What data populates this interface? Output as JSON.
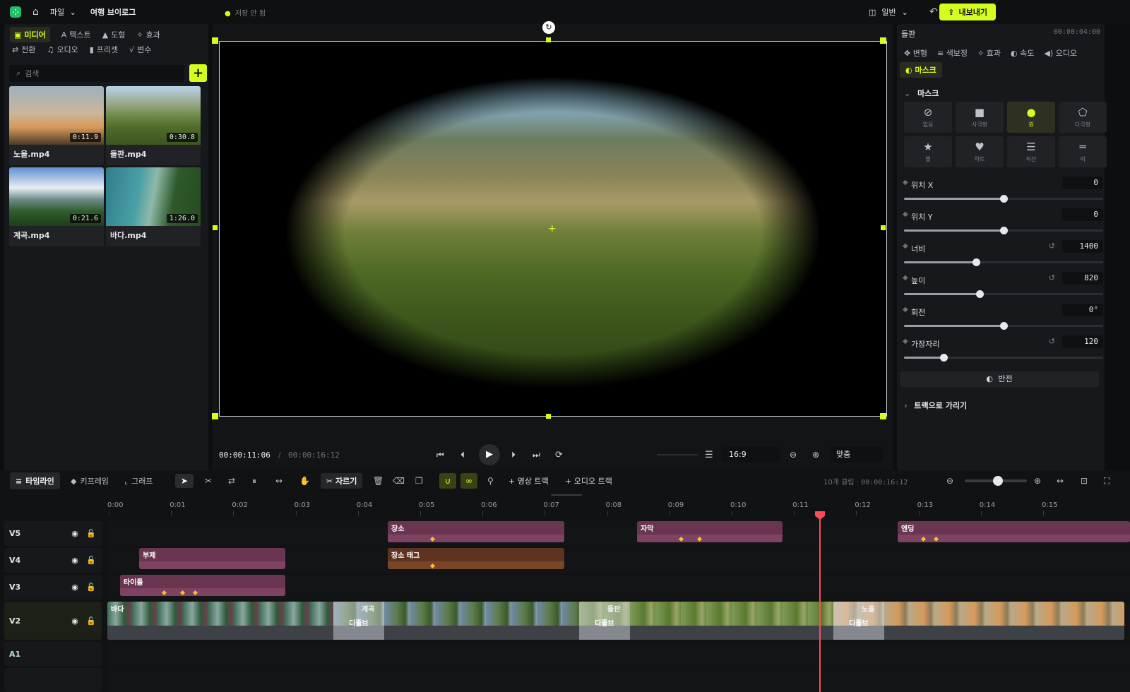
{
  "topbar": {
    "menu_file": "파일",
    "project_name": "여행 브이로그",
    "save_status": "저장 안 됨",
    "layout_mode": "일반",
    "export_label": "내보내기"
  },
  "media_panel": {
    "tabs": [
      {
        "label": "미디어",
        "icon": "media-icon"
      },
      {
        "label": "텍스트",
        "icon": "text-icon"
      },
      {
        "label": "도형",
        "icon": "shape-icon"
      },
      {
        "label": "효과",
        "icon": "effects-icon"
      },
      {
        "label": "전환",
        "icon": "transition-icon"
      },
      {
        "label": "오디오",
        "icon": "audio-icon"
      },
      {
        "label": "프리셋",
        "icon": "preset-icon"
      },
      {
        "label": "변수",
        "icon": "variable-icon"
      }
    ],
    "search_placeholder": "검색",
    "items": [
      {
        "name": "노을.mp4",
        "duration": "0:11.9"
      },
      {
        "name": "들판.mp4",
        "duration": "0:30.8"
      },
      {
        "name": "계곡.mp4",
        "duration": "0:21.6"
      },
      {
        "name": "바다.mp4",
        "duration": "1:26.0"
      }
    ]
  },
  "preview": {
    "current_time": "00:00:11:06",
    "total_time": "00:00:16:12",
    "aspect_ratio": "16:9",
    "zoom": "맞춤"
  },
  "inspector": {
    "clip_name": "들판",
    "clip_time": "00:00:04:00",
    "tabs": [
      "변형",
      "색보정",
      "효과",
      "속도",
      "오디오"
    ],
    "active_tab": "마스크",
    "mask_section_title": "마스크",
    "mask_shapes": [
      {
        "label": "없음",
        "icon": "none-icon"
      },
      {
        "label": "사각형",
        "icon": "rectangle-icon"
      },
      {
        "label": "원",
        "icon": "circle-icon",
        "selected": true
      },
      {
        "label": "다각형",
        "icon": "polygon-icon"
      },
      {
        "label": "별",
        "icon": "star-icon"
      },
      {
        "label": "하트",
        "icon": "heart-icon"
      },
      {
        "label": "직선",
        "icon": "line-icon"
      },
      {
        "label": "띠",
        "icon": "band-icon"
      }
    ],
    "properties": [
      {
        "name": "위치 X",
        "value": "0",
        "level": 0.5
      },
      {
        "name": "위치 Y",
        "value": "0",
        "level": 0.5
      },
      {
        "name": "너비",
        "value": "1400",
        "level": 0.36
      },
      {
        "name": "높이",
        "value": "820",
        "level": 0.38
      },
      {
        "name": "회전",
        "value": "0°",
        "level": 0.5
      },
      {
        "name": "가장자리",
        "value": "120",
        "level": 0.2
      }
    ],
    "invert_label": "반전",
    "track_section_title": "트랙으로 가리기"
  },
  "timeline": {
    "tabs": [
      "타임라인",
      "키프레임",
      "그래프"
    ],
    "cut_label": "자르기",
    "add_video_track": "영상 트랙",
    "add_audio_track": "오디오 트랙",
    "clip_count": "10개 클립",
    "total_time": "00:00:16:12",
    "ruler_marks": [
      "0:00",
      "0:01",
      "0:02",
      "0:03",
      "0:04",
      "0:05",
      "0:06",
      "0:07",
      "0:08",
      "0:09",
      "0:10",
      "0:11",
      "0:12",
      "0:13",
      "0:14",
      "0:15"
    ],
    "tracks": [
      {
        "name": "V5",
        "clips": [
          {
            "label": "장소",
            "color": "#7a3f57"
          },
          {
            "label": "자막",
            "color": "#7a3f57"
          },
          {
            "label": "엔딩",
            "color": "#7a3f57"
          }
        ]
      },
      {
        "name": "V4",
        "clips": [
          {
            "label": "부제",
            "color": "#7a3f57"
          },
          {
            "label": "장소 태그",
            "color": "#6b3a26"
          }
        ]
      },
      {
        "name": "V3",
        "clips": [
          {
            "label": "타이틀",
            "color": "#7a3f57"
          }
        ]
      },
      {
        "name": "V2",
        "clips": [
          {
            "label": "바다"
          },
          {
            "label": "계곡"
          },
          {
            "label": "들판"
          },
          {
            "label": "노을"
          }
        ],
        "transitions": [
          "디졸브",
          "디졸브",
          "디졸브"
        ]
      },
      {
        "name": "A1",
        "clips": []
      }
    ]
  }
}
